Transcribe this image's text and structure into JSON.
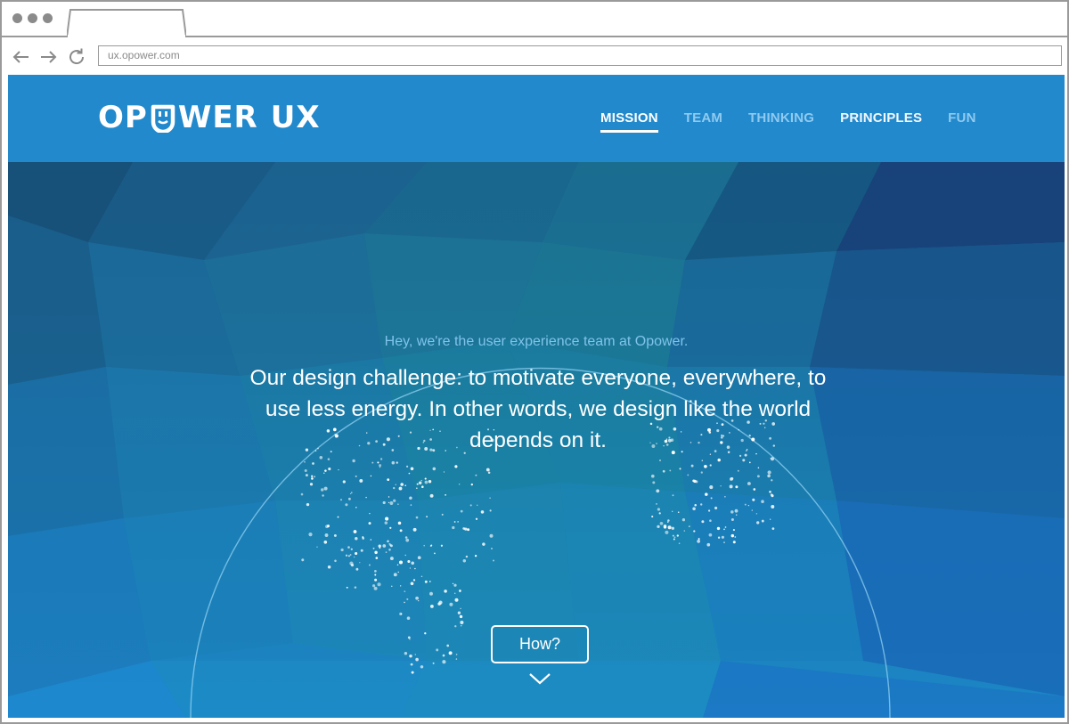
{
  "browser": {
    "url": "ux.opower.com",
    "icons": [
      "back-arrow-icon",
      "forward-arrow-icon",
      "reload-icon"
    ]
  },
  "header": {
    "logo_text_left": "OP",
    "logo_text_right": "WER",
    "logo_suffix": "UX",
    "nav": [
      {
        "label": "MISSION",
        "active": true
      },
      {
        "label": "TEAM",
        "active": false
      },
      {
        "label": "THINKING",
        "active": false
      },
      {
        "label": "PRINCIPLES",
        "active": false
      },
      {
        "label": "FUN",
        "active": false
      }
    ]
  },
  "hero": {
    "intro": "Hey, we're the user experience team at Opower.",
    "headline": "Our design challenge: to motivate everyone, everywhere, to use less energy. In other words, we design like the world depends on it.",
    "cta_label": "How?"
  },
  "colors": {
    "header_bg": "#2189cc",
    "nav_active": "#ffffff",
    "nav_inactive": "#8fcaf0",
    "intro_text": "#7fc3ea"
  }
}
